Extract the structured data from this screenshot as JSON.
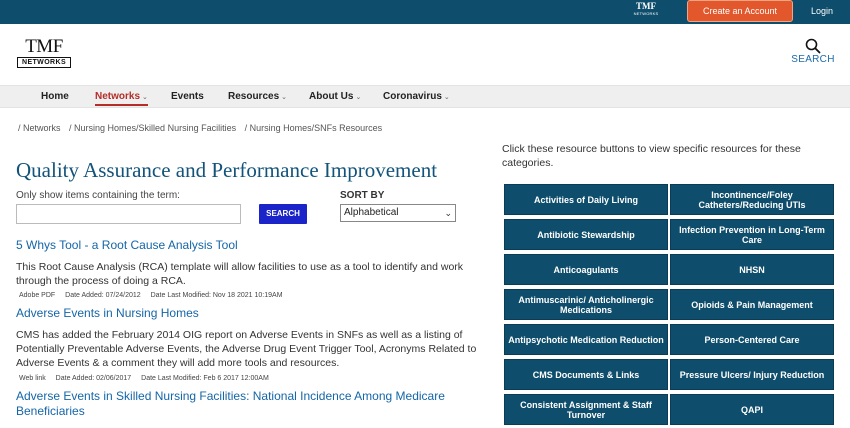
{
  "topbar": {
    "logo_line1": "TMF",
    "logo_line2": "NETWORKS",
    "create_account": "Create an Account",
    "login": "Login"
  },
  "header": {
    "logo_line1": "TMF",
    "logo_line2": "NETWORKS",
    "search_label": "SEARCH"
  },
  "nav": {
    "items": [
      {
        "label": "Home",
        "dropdown": false
      },
      {
        "label": "Networks",
        "dropdown": true,
        "active": true
      },
      {
        "label": "Events",
        "dropdown": false
      },
      {
        "label": "Resources",
        "dropdown": true
      },
      {
        "label": "About Us",
        "dropdown": true
      },
      {
        "label": "Coronavirus",
        "dropdown": true
      }
    ],
    "caret": "⌄"
  },
  "breadcrumb": [
    "/ Networks",
    "/ Nursing Homes/Skilled Nursing Facilities",
    "/ Nursing Homes/SNFs Resources"
  ],
  "page_title": "Quality Assurance and Performance Improvement",
  "filter": {
    "label": "Only show items containing the term:",
    "value": "",
    "button": "SEARCH"
  },
  "sort": {
    "label": "SORT BY",
    "selected": "Alphabetical"
  },
  "resources": [
    {
      "title": "5 Whys Tool - a Root Cause Analysis Tool",
      "description": "This Root Cause Analysis (RCA) template will allow facilities to use as a tool to identify and work through the process of doing a RCA.",
      "type": "Adobe PDF",
      "added": "Date Added: 07/24/2012",
      "modified": "Date Last Modified: Nov 18 2021 10:19AM"
    },
    {
      "title": "Adverse Events in Nursing Homes",
      "description": "CMS has added the February 2014 OIG report on Adverse Events in SNFs as well as a listing of Potentially Preventable Adverse Events, the Adverse Drug Event Trigger Tool, Acronyms Related to Adverse Events & a comment they will add more tools and resources.",
      "type": "Web link",
      "added": "Date Added: 02/06/2017",
      "modified": "Date Last Modified: Feb 6 2017 12:00AM"
    },
    {
      "title": "Adverse Events in Skilled Nursing Facilities: National Incidence Among Medicare Beneficiaries"
    }
  ],
  "sidebar": {
    "intro": "Click these resource buttons to view specific resources for these categories.",
    "tiles": [
      "Activities of Daily Living",
      "Incontinence/Foley Catheters/Reducing UTIs",
      "Antibiotic Stewardship",
      "Infection Prevention in Long-Term Care",
      "Anticoagulants",
      "NHSN",
      "Antimuscarinic/ Anticholinergic Medications",
      "Opioids & Pain Management",
      "Antipsychotic Medication Reduction",
      "Person-Centered Care",
      "CMS Documents & Links",
      "Pressure Ulcers/ Injury Reduction",
      "Consistent Assignment & Staff Turnover",
      "QAPI"
    ]
  },
  "colors": {
    "topbar": "#0e4d6b",
    "accent_orange": "#e2572b",
    "nav_active": "#b52d28",
    "title_blue": "#12537a",
    "link_blue": "#1466a8",
    "search_button": "#1a24c9"
  }
}
